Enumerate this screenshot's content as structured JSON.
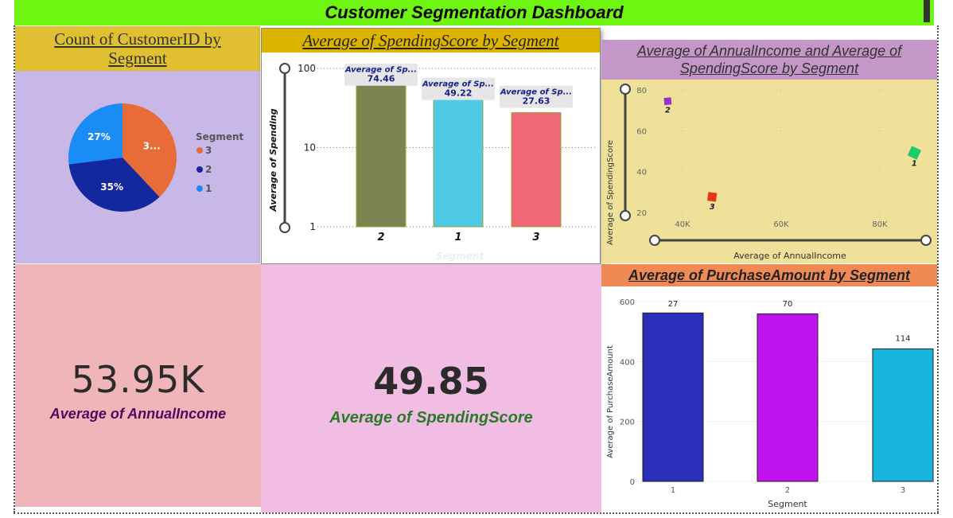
{
  "title": "Customer Segmentation Dashboard",
  "colors": {
    "title_bg": "#6ef511",
    "seg3": "#e86c38",
    "seg2": "#13279e",
    "seg1": "#1a8cf5",
    "spend_bar_2": "#7a8450",
    "spend_bar_1": "#4ec9e6",
    "spend_bar_3": "#ef6a74",
    "purch_bar_1": "#2b2eb8",
    "purch_bar_2": "#c013f0",
    "purch_bar_3": "#17b5de"
  },
  "pie": {
    "title": "Count of CustomerID by Segment",
    "legend_title": "Segment",
    "slice_labels": [
      "3...",
      "35%",
      "27%"
    ],
    "chart_data": {
      "type": "pie",
      "categories": [
        "3",
        "2",
        "1"
      ],
      "values": [
        38,
        35,
        27
      ],
      "legend": [
        "3",
        "2",
        "1"
      ]
    }
  },
  "spending": {
    "title": "Average of SpendingScore by Segment",
    "chart_data": {
      "type": "bar",
      "categories": [
        "2",
        "1",
        "3"
      ],
      "values": [
        74.46,
        49.22,
        27.63
      ],
      "data_label_names": [
        "Average of Sp...",
        "Average of Sp...",
        "Average of Sp..."
      ],
      "data_label_values": [
        "74.46",
        "49.22",
        "27.63"
      ],
      "ylabel": "Average of Spending",
      "xlabel": "Segment",
      "scale": "log",
      "yticks": [
        "1",
        "10",
        "100"
      ],
      "ylim": [
        1,
        100
      ]
    }
  },
  "scatter": {
    "title": "Average of AnnualIncome and Average of SpendingScore by Segment",
    "chart_data": {
      "type": "scatter",
      "points": [
        {
          "label": "2",
          "x": 37000,
          "y": 74.5,
          "color": "#9b2fc9"
        },
        {
          "label": "1",
          "x": 87000,
          "y": 49.2,
          "color": "#1fcb6c"
        },
        {
          "label": "3",
          "x": 46000,
          "y": 27.6,
          "color": "#e8361a"
        }
      ],
      "xlabel": "Average of AnnualIncome",
      "ylabel": "Average of SpendingScore",
      "xticks": [
        "40K",
        "60K",
        "80K"
      ],
      "yticks": [
        "20",
        "40",
        "60",
        "80"
      ],
      "xlim": [
        30000,
        90000
      ],
      "ylim": [
        18,
        82
      ]
    }
  },
  "kpi_income": {
    "value": "53.95K",
    "label": "Average of AnnualIncome"
  },
  "kpi_spend": {
    "value": "49.85",
    "label": "Average of SpendingScore"
  },
  "purchase": {
    "title": "Average of PurchaseAmount by Segment",
    "chart_data": {
      "type": "bar",
      "categories": [
        "1",
        "2",
        "3"
      ],
      "values": [
        562,
        559,
        442
      ],
      "data_labels": [
        "27",
        "70",
        "114"
      ],
      "ylabel": "Average of PurchaseAmount",
      "xlabel": "Segment",
      "yticks": [
        "0",
        "200",
        "400",
        "600"
      ],
      "ylim": [
        0,
        600
      ]
    }
  }
}
